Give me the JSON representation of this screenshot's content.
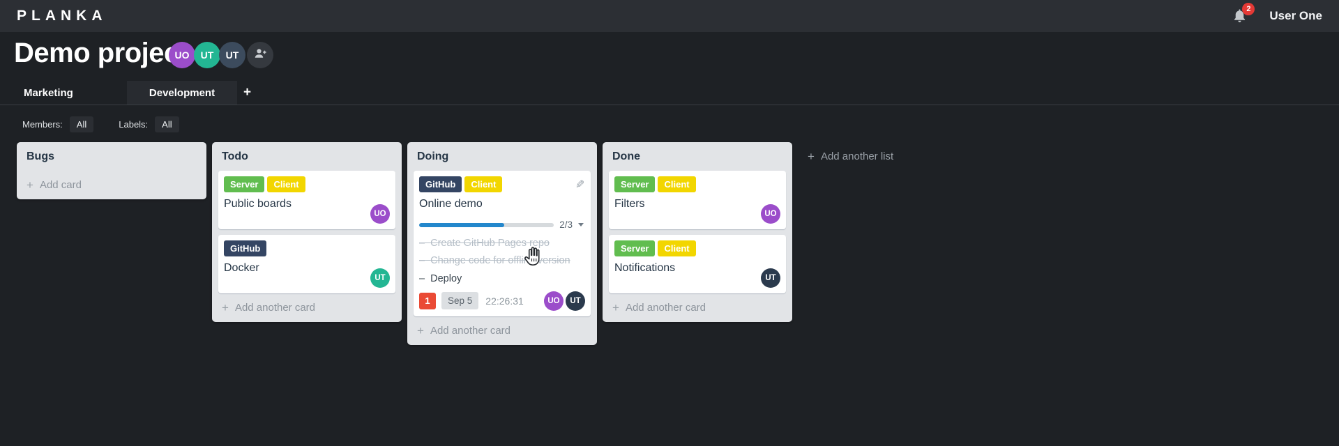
{
  "topbar": {
    "logo": "PLANKA",
    "notification_count": "2",
    "user_name": "User One"
  },
  "project": {
    "title": "Demo project",
    "members": [
      {
        "initials": "UO",
        "color": "#9b4dca"
      },
      {
        "initials": "UT",
        "color": "#23b693"
      },
      {
        "initials": "UT",
        "color": "#3c4b5d"
      }
    ]
  },
  "tabs": {
    "boards": [
      {
        "label": "Marketing",
        "active": false
      },
      {
        "label": "Development",
        "active": true
      }
    ]
  },
  "filters": {
    "members_label": "Members:",
    "members_value": "All",
    "labels_label": "Labels:",
    "labels_value": "All"
  },
  "icons": {
    "plus": "+",
    "pencil": "✎"
  },
  "board": {
    "add_list_label": "Add another list",
    "lists": [
      {
        "name": "Bugs",
        "add_card_label": "Add card",
        "cards": []
      },
      {
        "name": "Todo",
        "add_card_label": "Add another card",
        "cards": [
          {
            "title": "Public boards",
            "labels": [
              {
                "name": "Server",
                "color": "#61bd4f"
              },
              {
                "name": "Client",
                "color": "#f2d600"
              }
            ],
            "members": [
              {
                "initials": "UO",
                "color": "#9b4dca"
              }
            ]
          },
          {
            "title": "Docker",
            "labels": [
              {
                "name": "GitHub",
                "color": "#344563"
              }
            ],
            "members": [
              {
                "initials": "UT",
                "color": "#23b693"
              }
            ]
          }
        ]
      },
      {
        "name": "Doing",
        "add_card_label": "Add another card",
        "cards": [
          {
            "title": "Online demo",
            "labels": [
              {
                "name": "GitHub",
                "color": "#344563"
              },
              {
                "name": "Client",
                "color": "#f2d600"
              }
            ],
            "progress": {
              "done": 2,
              "total": 3,
              "label": "2/3",
              "percent": "63%",
              "color": "#2387cc"
            },
            "tasks": [
              {
                "text": "Create GitHub Pages repo",
                "done": true
              },
              {
                "text": "Change code for offline version",
                "done": true
              },
              {
                "text": "Deploy",
                "done": false
              }
            ],
            "notification_count": "1",
            "due_date": "Sep 5",
            "timer": "22:26:31",
            "members": [
              {
                "initials": "UO",
                "color": "#9b4dca"
              },
              {
                "initials": "UT",
                "color": "#2b3a4d"
              }
            ]
          }
        ]
      },
      {
        "name": "Done",
        "add_card_label": "Add another card",
        "cards": [
          {
            "title": "Filters",
            "labels": [
              {
                "name": "Server",
                "color": "#61bd4f"
              },
              {
                "name": "Client",
                "color": "#f2d600"
              }
            ],
            "members": [
              {
                "initials": "UO",
                "color": "#9b4dca"
              }
            ]
          },
          {
            "title": "Notifications",
            "labels": [
              {
                "name": "Server",
                "color": "#61bd4f"
              },
              {
                "name": "Client",
                "color": "#f2d600"
              }
            ],
            "members": [
              {
                "initials": "UT",
                "color": "#2b3a4d"
              }
            ]
          }
        ]
      }
    ]
  },
  "theme": {
    "topbar_bg": "#2c2f34",
    "page_bg": "#1e2125",
    "list_bg": "#e2e4e7",
    "progress_blue": "#2387cc",
    "danger_red": "#ea4a35",
    "badge_red": "#e53935"
  }
}
